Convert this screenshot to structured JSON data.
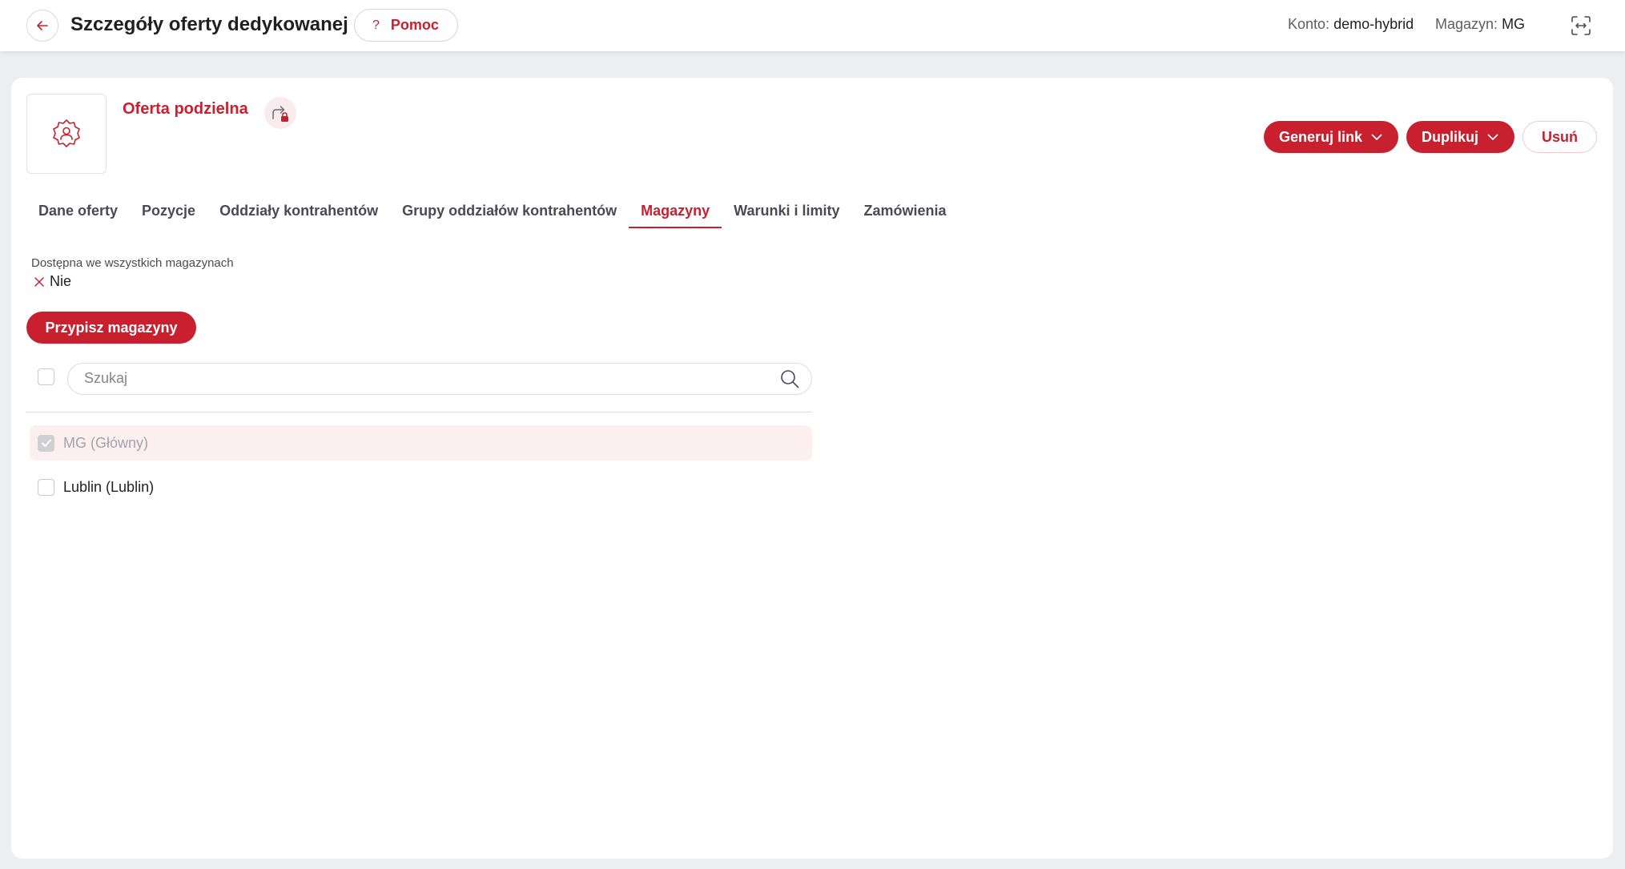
{
  "header": {
    "title": "Szczegóły oferty dedykowanej",
    "help_label": "Pomoc",
    "help_icon": "?",
    "account_label": "Konto:",
    "account_value": "demo-hybrid",
    "warehouse_label": "Magazyn:",
    "warehouse_value": "MG"
  },
  "offer": {
    "title": "Oferta podzielna",
    "icon": "badge-user-icon"
  },
  "actions": {
    "generate_link": "Generuj link",
    "duplicate": "Duplikuj",
    "delete": "Usuń"
  },
  "tabs": [
    {
      "label": "Dane oferty",
      "active": false
    },
    {
      "label": "Pozycje",
      "active": false
    },
    {
      "label": "Oddziały kontrahentów",
      "active": false
    },
    {
      "label": "Grupy oddziałów kontrahentów",
      "active": false
    },
    {
      "label": "Magazyny",
      "active": true
    },
    {
      "label": "Warunki i limity",
      "active": false
    },
    {
      "label": "Zamówienia",
      "active": false
    }
  ],
  "availability": {
    "label": "Dostępna we wszystkich magazynach",
    "value": "Nie"
  },
  "assign_button": "Przypisz magazyny",
  "search": {
    "placeholder": "Szukaj",
    "value": ""
  },
  "warehouses": [
    {
      "label": "MG (Główny)",
      "checked": true,
      "disabled": true
    },
    {
      "label": "Lublin (Lublin)",
      "checked": false,
      "disabled": false
    }
  ],
  "colors": {
    "accent": "#c8202f",
    "background": "#eceef1"
  }
}
